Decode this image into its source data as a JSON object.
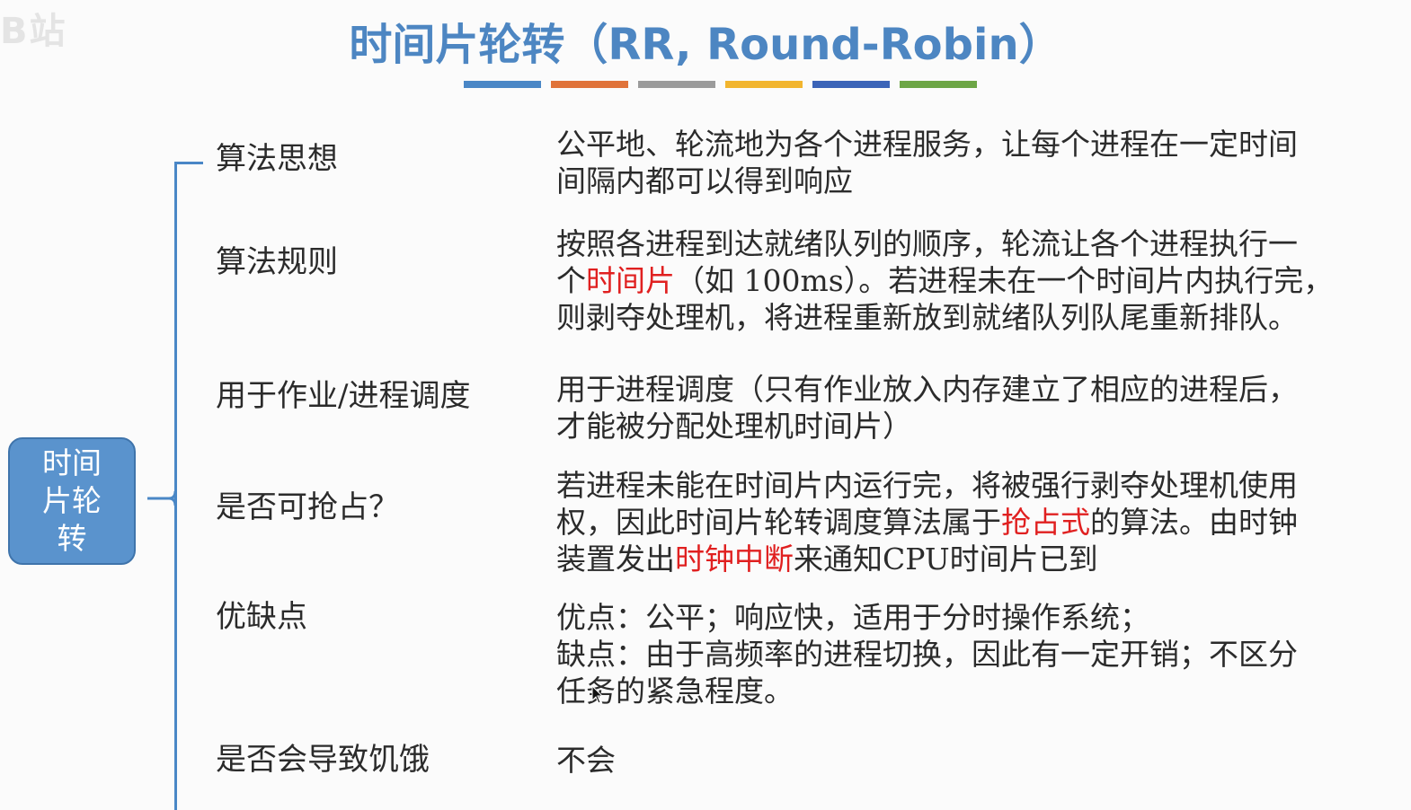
{
  "watermark": "B站",
  "title": "时间片轮转（RR, Round-Robin）",
  "title_bar_colors": [
    "#4a87c6",
    "#e0733a",
    "#9b9b9b",
    "#f2b52e",
    "#3b64b8",
    "#6da646"
  ],
  "root_node": "时间片轮转",
  "accent_color": "#e02020",
  "rows": [
    {
      "label": "算法思想",
      "lines": [
        [
          {
            "t": "公平地、轮流地为各个进程服务，让每个进程在一定时间"
          }
        ],
        [
          {
            "t": "间隔内都可以得到响应"
          }
        ]
      ]
    },
    {
      "label": "算法规则",
      "lines": [
        [
          {
            "t": "按照各进程到达就绪队列的顺序，轮流让各个进程执行一"
          }
        ],
        [
          {
            "t": "个"
          },
          {
            "t": "时间片",
            "red": true
          },
          {
            "t": "（如 100ms）。若进程未在一个时间片内执行完，"
          }
        ],
        [
          {
            "t": "则剥夺处理机，将进程重新放到就绪队列队尾重新排队。"
          }
        ]
      ]
    },
    {
      "label": "用于作业/进程调度",
      "lines": [
        [
          {
            "t": "用于进程调度（只有作业放入内存建立了相应的进程后，"
          }
        ],
        [
          {
            "t": "才能被分配处理机时间片）"
          }
        ]
      ]
    },
    {
      "label": "是否可抢占？",
      "lines": [
        [
          {
            "t": "若进程未能在时间片内运行完，将被强行剥夺处理机使用"
          }
        ],
        [
          {
            "t": "权，因此时间片轮转调度算法属于"
          },
          {
            "t": "抢占式",
            "red": true
          },
          {
            "t": "的算法。由时钟"
          }
        ],
        [
          {
            "t": "装置发出"
          },
          {
            "t": "时钟中断",
            "red": true
          },
          {
            "t": "来通知CPU时间片已到"
          }
        ]
      ]
    },
    {
      "label": "优缺点",
      "lines": [
        [
          {
            "t": "优点：公平；响应快，适用于分时操作系统；"
          }
        ],
        [
          {
            "t": "缺点：由于高频率的进程切换，因此有一定开销；不区分"
          }
        ],
        [
          {
            "t": "任务的紧急程度。"
          }
        ]
      ]
    },
    {
      "label": "是否会导致饥饿",
      "lines": [
        [
          {
            "t": "不会"
          }
        ]
      ]
    }
  ]
}
